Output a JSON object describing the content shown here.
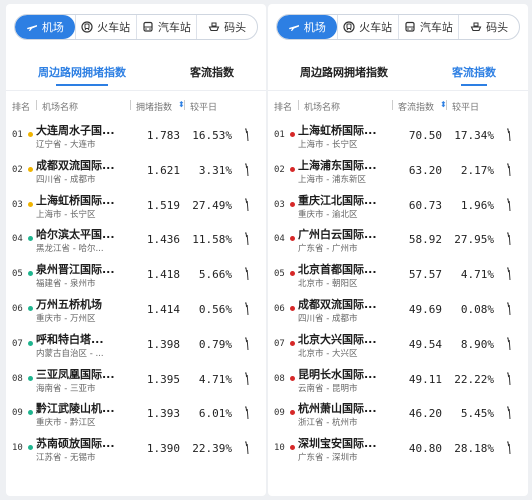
{
  "mode_tabs": [
    {
      "label": "机场",
      "icon": "plane-icon",
      "active": true
    },
    {
      "label": "火车站",
      "icon": "train-icon",
      "active": false
    },
    {
      "label": "汽车站",
      "icon": "bus-icon",
      "active": false
    },
    {
      "label": "码头",
      "icon": "ship-icon",
      "active": false
    }
  ],
  "colors": {
    "accent": "#2d7fe3",
    "dot_yellow": "#f0b400",
    "dot_green": "#1fb58f",
    "dot_red": "#d62828"
  },
  "left_panel": {
    "tabs": {
      "congestion": "周边路网拥堵指数",
      "flow": "客流指数",
      "active": "congestion"
    },
    "headers": {
      "rank": "排名",
      "name": "机场名称",
      "value": "拥堵指数",
      "change": "较平日"
    },
    "rows": [
      {
        "rank": "01",
        "name": "大连周水子国...",
        "sub": "辽宁省 - 大连市",
        "value": "1.783",
        "change": "16.53%",
        "dot": "yellow"
      },
      {
        "rank": "02",
        "name": "成都双流国际...",
        "sub": "四川省 - 成都市",
        "value": "1.621",
        "change": "3.31%",
        "dot": "yellow"
      },
      {
        "rank": "03",
        "name": "上海虹桥国际...",
        "sub": "上海市 - 长宁区",
        "value": "1.519",
        "change": "27.49%",
        "dot": "yellow"
      },
      {
        "rank": "04",
        "name": "哈尔滨太平国...",
        "sub": "黑龙江省 - 哈尔...",
        "value": "1.436",
        "change": "11.58%",
        "dot": "green"
      },
      {
        "rank": "05",
        "name": "泉州晋江国际...",
        "sub": "福建省 - 泉州市",
        "value": "1.418",
        "change": "5.66%",
        "dot": "green"
      },
      {
        "rank": "06",
        "name": "万州五桥机场",
        "sub": "重庆市 - 万州区",
        "value": "1.414",
        "change": "0.56%",
        "dot": "green"
      },
      {
        "rank": "07",
        "name": "呼和特白塔...",
        "sub": "内蒙古自治区 - ...",
        "value": "1.398",
        "change": "0.79%",
        "dot": "green"
      },
      {
        "rank": "08",
        "name": "三亚凤凰国际...",
        "sub": "海南省 - 三亚市",
        "value": "1.395",
        "change": "4.71%",
        "dot": "green"
      },
      {
        "rank": "09",
        "name": "黔江武陵山机...",
        "sub": "重庆市 - 黔江区",
        "value": "1.393",
        "change": "6.01%",
        "dot": "green"
      },
      {
        "rank": "10",
        "name": "苏南硕放国际...",
        "sub": "江苏省 - 无锡市",
        "value": "1.390",
        "change": "22.39%",
        "dot": "green"
      }
    ]
  },
  "right_panel": {
    "tabs": {
      "congestion": "周边路网拥堵指数",
      "flow": "客流指数",
      "active": "flow"
    },
    "headers": {
      "rank": "排名",
      "name": "机场名称",
      "value": "客流指数",
      "change": "较平日"
    },
    "rows": [
      {
        "rank": "01",
        "name": "上海虹桥国际...",
        "sub": "上海市 - 长宁区",
        "value": "70.50",
        "change": "17.34%",
        "dot": "red"
      },
      {
        "rank": "02",
        "name": "上海浦东国际...",
        "sub": "上海市 - 浦东新区",
        "value": "63.20",
        "change": "2.17%",
        "dot": "red"
      },
      {
        "rank": "03",
        "name": "重庆江北国际...",
        "sub": "重庆市 - 渝北区",
        "value": "60.73",
        "change": "1.96%",
        "dot": "red"
      },
      {
        "rank": "04",
        "name": "广州白云国际...",
        "sub": "广东省 - 广州市",
        "value": "58.92",
        "change": "27.95%",
        "dot": "red"
      },
      {
        "rank": "05",
        "name": "北京首都国际...",
        "sub": "北京市 - 朝阳区",
        "value": "57.57",
        "change": "4.71%",
        "dot": "red"
      },
      {
        "rank": "06",
        "name": "成都双流国际...",
        "sub": "四川省 - 成都市",
        "value": "49.69",
        "change": "0.08%",
        "dot": "red"
      },
      {
        "rank": "07",
        "name": "北京大兴国际...",
        "sub": "北京市 - 大兴区",
        "value": "49.54",
        "change": "8.90%",
        "dot": "red"
      },
      {
        "rank": "08",
        "name": "昆明长水国际...",
        "sub": "云南省 - 昆明市",
        "value": "49.11",
        "change": "22.22%",
        "dot": "red"
      },
      {
        "rank": "09",
        "name": "杭州萧山国际...",
        "sub": "浙江省 - 杭州市",
        "value": "46.20",
        "change": "5.45%",
        "dot": "red"
      },
      {
        "rank": "10",
        "name": "深圳宝安国际...",
        "sub": "广东省 - 深圳市",
        "value": "40.80",
        "change": "28.18%",
        "dot": "red"
      }
    ]
  }
}
